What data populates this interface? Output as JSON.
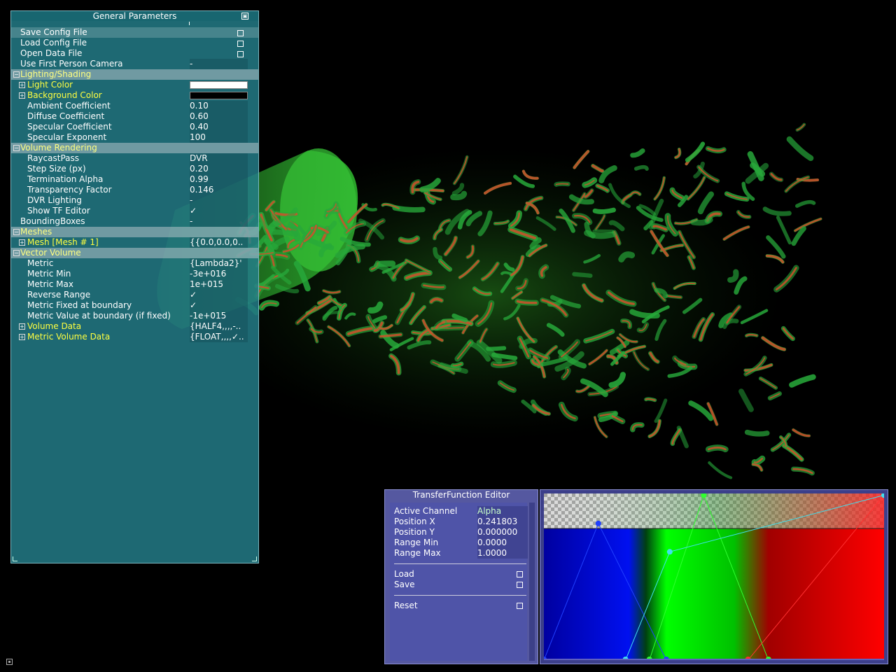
{
  "general_parameters": {
    "title": "General Parameters",
    "rows": [
      {
        "label": "Save Config File",
        "value": ""
      },
      {
        "label": "Load Config File",
        "value": ""
      },
      {
        "label": "Open Data File",
        "value": ""
      },
      {
        "label": "Use First Person Camera",
        "value": "-"
      },
      {
        "label": "Lighting/Shading",
        "value": ""
      },
      {
        "label": "Light Color",
        "value": ""
      },
      {
        "label": "Background Color",
        "value": ""
      },
      {
        "label": "Ambient Coefficient",
        "value": "0.10"
      },
      {
        "label": "Diffuse Coefficient",
        "value": "0.60"
      },
      {
        "label": "Specular Coefficient",
        "value": "0.40"
      },
      {
        "label": "Specular Exponent",
        "value": "100"
      },
      {
        "label": "Volume Rendering",
        "value": ""
      },
      {
        "label": "RaycastPass",
        "value": "DVR"
      },
      {
        "label": "Step Size (px)",
        "value": "0.20"
      },
      {
        "label": "Termination Alpha",
        "value": "0.99"
      },
      {
        "label": "Transparency Factor",
        "value": "0.146"
      },
      {
        "label": "DVR Lighting",
        "value": "-"
      },
      {
        "label": "Show TF Editor",
        "value": "✓"
      },
      {
        "label": "BoundingBoxes",
        "value": "-"
      },
      {
        "label": "Meshes",
        "value": ""
      },
      {
        "label": "Mesh [Mesh # 1]",
        "value": "{{0.0,0.0,0.."
      },
      {
        "label": "Vector Volume",
        "value": ""
      },
      {
        "label": "Metric",
        "value": "{Lambda2}'"
      },
      {
        "label": "Metric Min",
        "value": "-3e+016"
      },
      {
        "label": "Metric Max",
        "value": "1e+015"
      },
      {
        "label": "Reverse Range",
        "value": "✓"
      },
      {
        "label": "Metric Fixed at boundary",
        "value": "✓"
      },
      {
        "label": "Metric Value at boundary (if fixed)",
        "value": "-1e+015"
      },
      {
        "label": "Volume Data",
        "value": "{HALF4,,,,-.."
      },
      {
        "label": "Metric Volume Data",
        "value": "{FLOAT,,,,✓.."
      }
    ],
    "light_color": "#ffffff",
    "background_color": "#000000"
  },
  "tf_editor": {
    "title": "TransferFunction Editor",
    "fields": [
      {
        "label": "Active Channel",
        "value": "Alpha"
      },
      {
        "label": "Position X",
        "value": "0.241803"
      },
      {
        "label": "Position Y",
        "value": "0.000000"
      },
      {
        "label": "Range Min",
        "value": "0.0000"
      },
      {
        "label": "Range Max",
        "value": "1.0000"
      }
    ],
    "actions": {
      "load": "Load",
      "save": "Save",
      "reset": "Reset"
    }
  },
  "colors": {
    "panel_bg": "#24808c",
    "section_label": "#ffff80",
    "expandable_label": "#ffff40",
    "tf_bg": "#5558a0",
    "alpha_curve": "#40e0f0"
  }
}
